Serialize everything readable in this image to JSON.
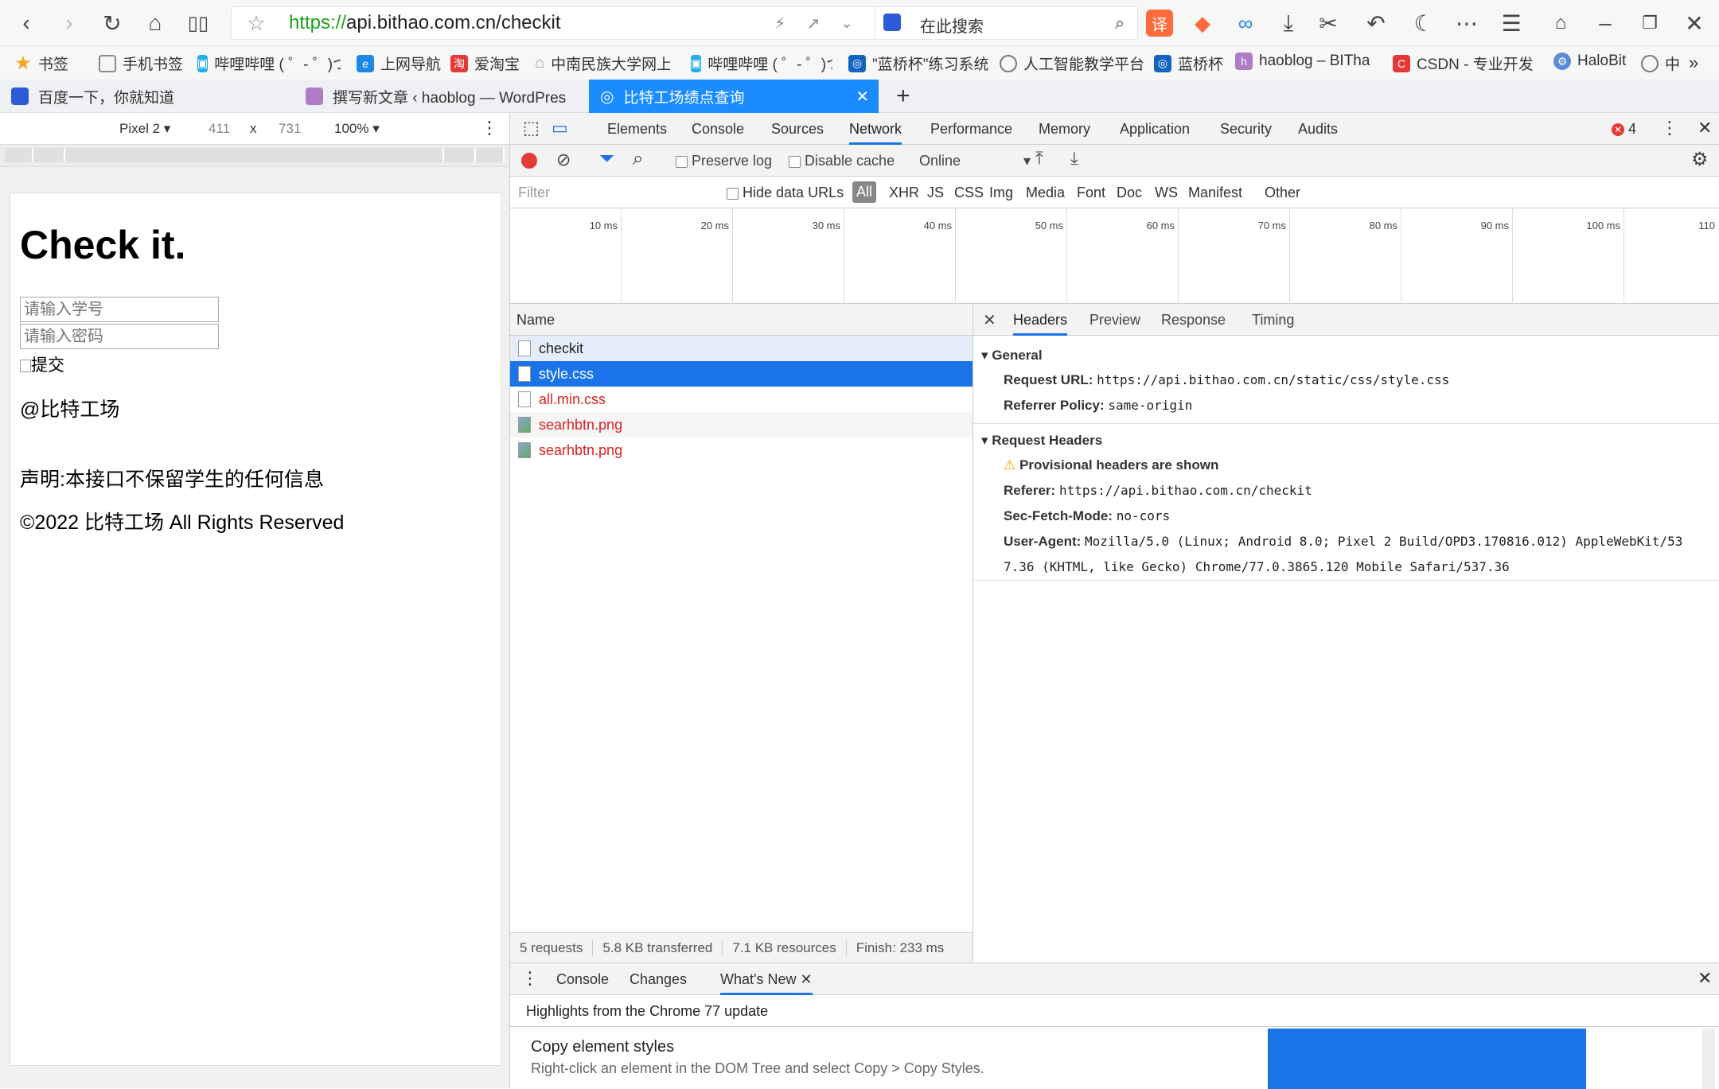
{
  "browser": {
    "url_scheme": "https://",
    "url_rest": "api.bithao.com.cn/checkit",
    "search_placeholder": "在此搜索"
  },
  "bookmarks": [
    {
      "label": "书签",
      "color": "#f5a623"
    },
    {
      "label": "手机书签",
      "color": "#888888"
    },
    {
      "label": "哔哩哔哩 ( ゜- ゜)つ",
      "color": "#23ade5"
    },
    {
      "label": "上网导航",
      "color": "#1e88e5"
    },
    {
      "label": "爱淘宝",
      "color": "#e53935"
    },
    {
      "label": "中南民族大学网上",
      "color": "#999999"
    },
    {
      "label": "哔哩哔哩 ( ゜- ゜)つ",
      "color": "#23ade5"
    },
    {
      "label": "\"蓝桥杯\"练习系统",
      "color": "#1565c0"
    },
    {
      "label": "人工智能教学平台",
      "color": "#777777"
    },
    {
      "label": "蓝桥杯",
      "color": "#1565c0"
    },
    {
      "label": "haoblog – BITha",
      "color": "#b07bc6"
    },
    {
      "label": "CSDN - 专业开发",
      "color": "#e53935"
    },
    {
      "label": "HaloBit",
      "color": "#5b8bd6"
    },
    {
      "label": "中",
      "color": "#777777"
    }
  ],
  "tabs": [
    {
      "label": "百度一下，你就知道"
    },
    {
      "label": "撰写新文章 ‹ haoblog — WordPres"
    },
    {
      "label": "比特工场绩点查询"
    }
  ],
  "device": {
    "name": "Pixel 2",
    "width": "411",
    "x": "x",
    "height": "731",
    "zoom": "100%"
  },
  "page": {
    "title": "Check it.",
    "student_id_placeholder": "请输入学号",
    "password_placeholder": "请输入密码",
    "submit_alt": "提交",
    "brand": "@比特工场",
    "disclaimer": "声明:本接口不保留学生的任何信息",
    "copyright": "©2022 比特工场 All Rights Reserved"
  },
  "devtools": {
    "tabs": [
      "Elements",
      "Console",
      "Sources",
      "Network",
      "Performance",
      "Memory",
      "Application",
      "Security",
      "Audits"
    ],
    "active_tab": "Network",
    "error_count": "4",
    "preserve_log": "Preserve log",
    "disable_cache": "Disable cache",
    "throttle": "Online",
    "filter_placeholder": "Filter",
    "hide_data_urls": "Hide data URLs",
    "filter_types": [
      "All",
      "XHR",
      "JS",
      "CSS",
      "Img",
      "Media",
      "Font",
      "Doc",
      "WS",
      "Manifest",
      "Other"
    ],
    "timeline_ticks": [
      "10 ms",
      "20 ms",
      "30 ms",
      "40 ms",
      "50 ms",
      "60 ms",
      "70 ms",
      "80 ms",
      "90 ms",
      "100 ms",
      "110"
    ],
    "name_header": "Name",
    "requests": [
      {
        "name": "checkit",
        "kind": "doc"
      },
      {
        "name": "style.css",
        "kind": "doc"
      },
      {
        "name": "all.min.css",
        "kind": "doc"
      },
      {
        "name": "searhbtn.png",
        "kind": "img"
      },
      {
        "name": "searhbtn.png",
        "kind": "img"
      }
    ],
    "summary": [
      "5 requests",
      "5.8 KB transferred",
      "7.1 KB resources",
      "Finish: 233 ms"
    ],
    "detail_tabs": [
      "Headers",
      "Preview",
      "Response",
      "Timing"
    ],
    "general_title": "General",
    "request_url_label": "Request URL:",
    "request_url": "https://api.bithao.com.cn/static/css/style.css",
    "referrer_policy_label": "Referrer Policy:",
    "referrer_policy": "same-origin",
    "request_headers_title": "Request Headers",
    "provisional": "Provisional headers are shown",
    "referer_label": "Referer:",
    "referer": "https://api.bithao.com.cn/checkit",
    "sec_fetch_label": "Sec-Fetch-Mode:",
    "sec_fetch": "no-cors",
    "ua_label": "User-Agent:",
    "ua_line1": "Mozilla/5.0 (Linux; Android 8.0; Pixel 2 Build/OPD3.170816.012) AppleWebKit/53",
    "ua_line2": "7.36 (KHTML, like Gecko) Chrome/77.0.3865.120 Mobile Safari/537.36",
    "drawer_tabs": [
      "Console",
      "Changes",
      "What's New"
    ],
    "drawer_highlight": "Highlights from the Chrome 77 update",
    "drawer_item_title": "Copy element styles",
    "drawer_item_desc": "Right-click an element in the DOM Tree and select Copy > Copy Styles."
  }
}
